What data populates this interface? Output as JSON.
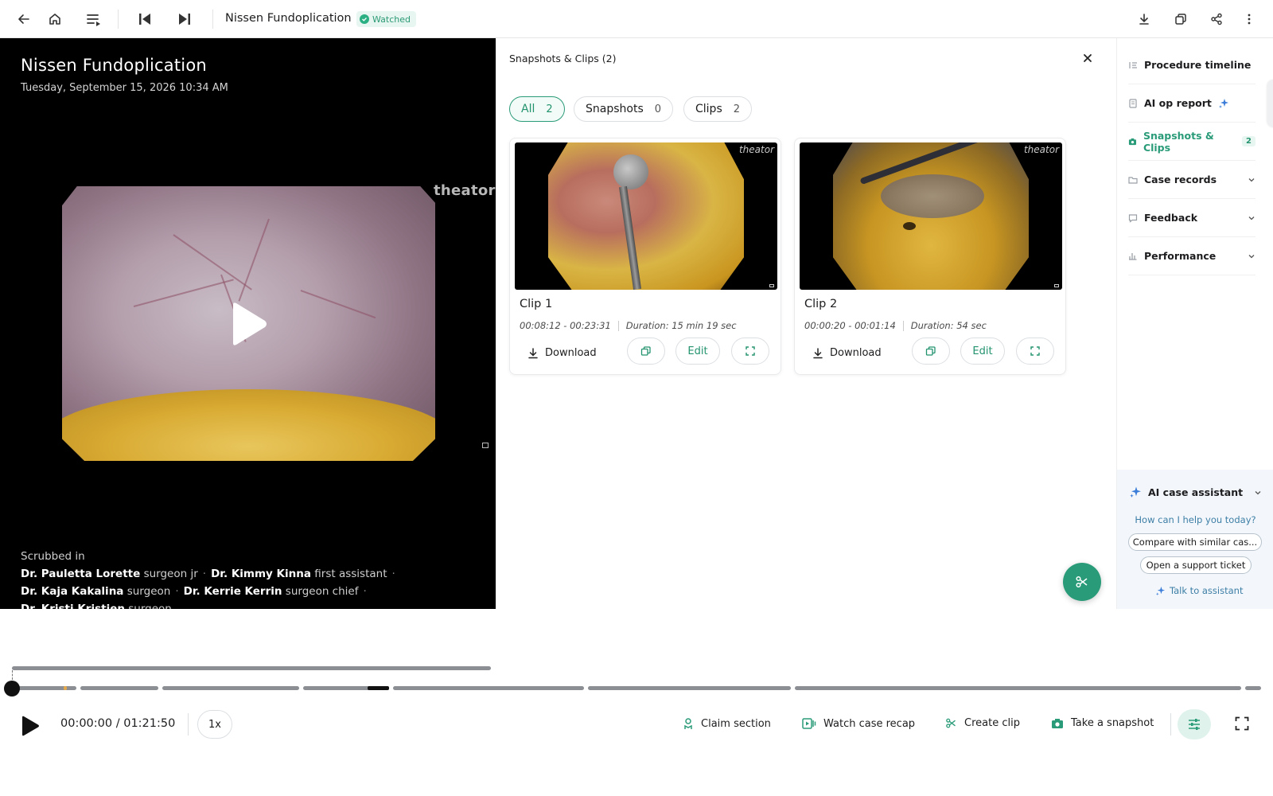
{
  "topbar": {
    "title": "Nissen Fundoplication",
    "watched_label": "Watched",
    "icons": [
      "back-arrow-icon",
      "home-icon",
      "playlist-icon",
      "previous-icon",
      "next-icon",
      "download-icon",
      "copy-icon",
      "share-icon",
      "more-icon"
    ]
  },
  "video": {
    "title": "Nissen Fundoplication",
    "date": "Tuesday, September 15, 2026 10:34 AM",
    "watermark": "theator",
    "scrubbed_label": "Scrubbed in",
    "people": [
      {
        "name": "Dr. Pauletta Lorette",
        "role": "surgeon jr"
      },
      {
        "name": "Dr. Kimmy Kinna",
        "role": "first assistant"
      },
      {
        "name": "Dr. Kaja Kakalina",
        "role": "surgeon"
      },
      {
        "name": "Dr. Kerrie Kerrin",
        "role": "surgeon chief"
      },
      {
        "name": "Dr. Kristi Kristien",
        "role": "surgeon"
      }
    ]
  },
  "panel": {
    "title": "Snapshots & Clips (2)",
    "filters": [
      {
        "label": "All",
        "count": "2"
      },
      {
        "label": "Snapshots",
        "count": "0"
      },
      {
        "label": "Clips",
        "count": "2"
      }
    ],
    "clips": [
      {
        "name": "Clip 1",
        "range": "00:08:12 - 00:23:31",
        "duration": "Duration: 15 min 19 sec",
        "download": "Download",
        "edit": "Edit",
        "watermark": "theator"
      },
      {
        "name": "Clip 2",
        "range": "00:00:20 - 00:01:14",
        "duration": "Duration: 54 sec",
        "download": "Download",
        "edit": "Edit",
        "watermark": "theator"
      }
    ]
  },
  "sidebar": {
    "items": [
      {
        "label": "Procedure timeline"
      },
      {
        "label": "AI op report"
      },
      {
        "label": "Snapshots & Clips",
        "badge": "2"
      },
      {
        "label": "Case records"
      },
      {
        "label": "Feedback"
      },
      {
        "label": "Performance"
      }
    ],
    "assistant": {
      "title": "AI case assistant",
      "question": "How can I help you today?",
      "suggestions": [
        "Compare with similar cas...",
        "Open a support ticket"
      ],
      "talk": "Talk to assistant"
    }
  },
  "player": {
    "time": "00:00:00 / 01:21:50",
    "speed": "1x",
    "progress": 0,
    "actions": [
      "Claim section",
      "Watch case recap",
      "Create clip",
      "Take a snapshot"
    ]
  },
  "colors": {
    "accent": "#2a9b78",
    "accent_light": "#e8f6f1",
    "assistant_blue": "#3d7ea6"
  }
}
